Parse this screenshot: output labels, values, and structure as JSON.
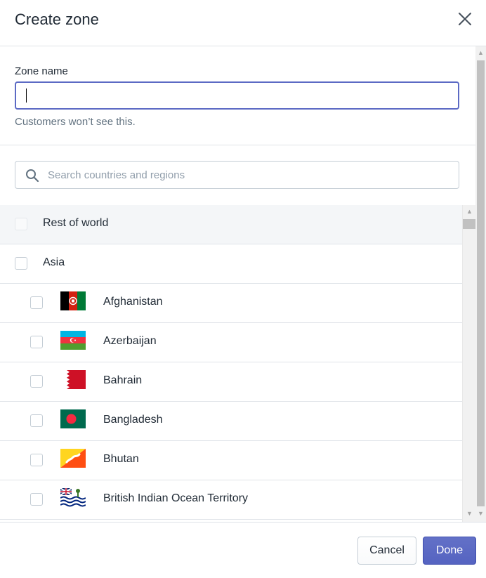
{
  "dialog": {
    "title": "Create zone"
  },
  "zone": {
    "label": "Zone name",
    "value": "",
    "help": "Customers won’t see this."
  },
  "search": {
    "placeholder": "Search countries and regions"
  },
  "list": {
    "rest_of_world": "Rest of world",
    "group": "Asia",
    "countries": [
      {
        "name": "Afghanistan",
        "flag": "afghanistan-flag"
      },
      {
        "name": "Azerbaijan",
        "flag": "azerbaijan-flag"
      },
      {
        "name": "Bahrain",
        "flag": "bahrain-flag"
      },
      {
        "name": "Bangladesh",
        "flag": "bangladesh-flag"
      },
      {
        "name": "Bhutan",
        "flag": "bhutan-flag"
      },
      {
        "name": "British Indian Ocean Territory",
        "flag": "british-indian-ocean-territory-flag"
      }
    ]
  },
  "footer": {
    "cancel_label": "Cancel",
    "done_label": "Done"
  },
  "colors": {
    "accent": "#5c6ac4",
    "primary_button": "#5563c1",
    "border": "#dfe3e8"
  }
}
